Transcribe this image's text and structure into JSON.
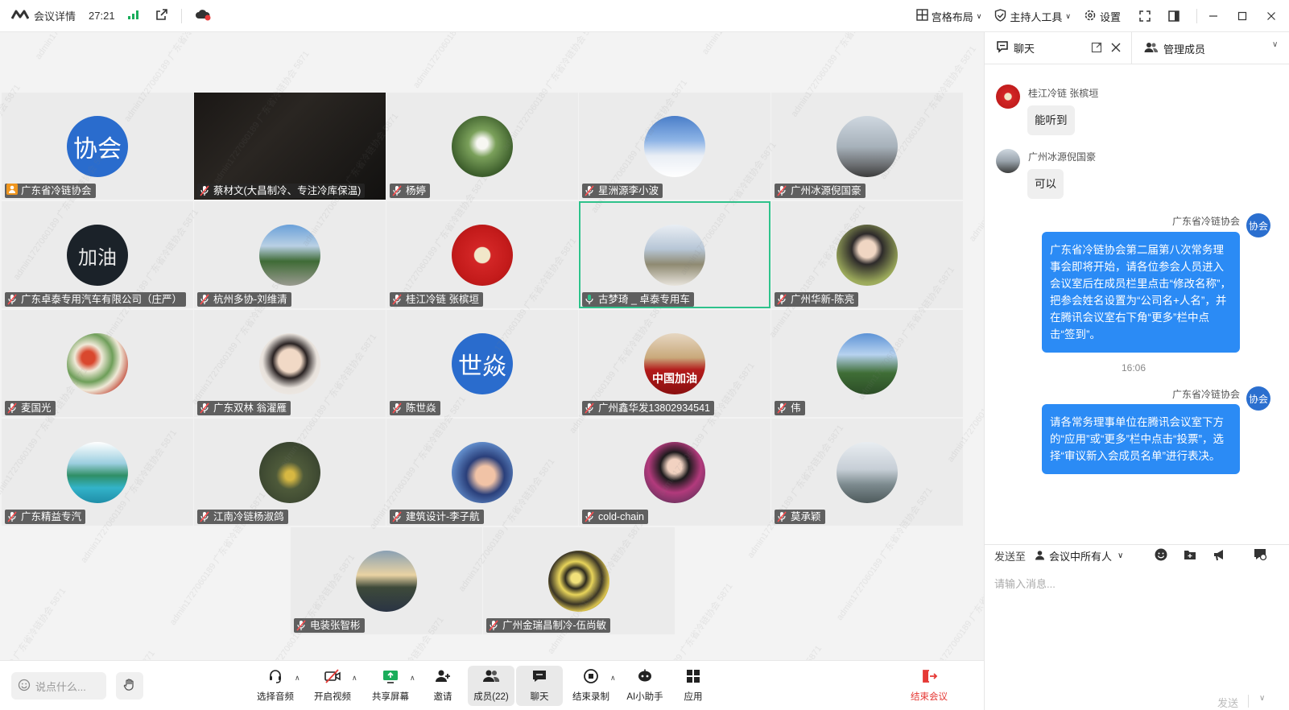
{
  "topbar": {
    "meeting_details": "会议详情",
    "timer": "27:21",
    "layout_label": "宫格布局",
    "host_tools_label": "主持人工具",
    "settings_label": "设置"
  },
  "participants": [
    {
      "name": "广东省冷链协会",
      "avatar_text": "协会",
      "role_icon": "host"
    },
    {
      "name": "蔡材文(大昌制冷、专注冷库保温)"
    },
    {
      "name": "杨婷"
    },
    {
      "name": "星洲源李小波"
    },
    {
      "name": "广州冰源倪国豪"
    },
    {
      "name": "广东卓泰专用汽车有限公司（庄严）",
      "avatar_text": "加油"
    },
    {
      "name": "杭州多协-刘维清"
    },
    {
      "name": "桂江冷链 张槟垣"
    },
    {
      "name": "古梦琦 _ 卓泰专用车",
      "active": true
    },
    {
      "name": "广州华新-陈亮"
    },
    {
      "name": "麦国光"
    },
    {
      "name": "广东双林 翁濯雁"
    },
    {
      "name": "陈世焱",
      "avatar_text": "世焱"
    },
    {
      "name": "广州鑫华发13802934541",
      "avatar_text": "中国加油"
    },
    {
      "name": "伟"
    },
    {
      "name": "广东精益专汽"
    },
    {
      "name": "江南冷链杨淑鸽"
    },
    {
      "name": "建筑设计-李子航"
    },
    {
      "name": "cold-chain"
    },
    {
      "name": "莫承颖"
    },
    {
      "name": "电装张智彬"
    },
    {
      "name": "广州金瑞昌制冷-伍尚敏"
    }
  ],
  "watermark": "admin1727060189 广东省冷链协会 5871",
  "bottombar": {
    "say_placeholder": "说点什么...",
    "audio": "选择音频",
    "video": "开启视频",
    "share": "共享屏幕",
    "invite": "邀请",
    "members": "成员(22)",
    "chat": "聊天",
    "record": "结束录制",
    "ai": "AI小助手",
    "apps": "应用",
    "end": "结束会议"
  },
  "sidebar": {
    "chat_tab": "聊天",
    "members_tab": "管理成员",
    "messages": [
      {
        "sender": "桂江冷链 张槟垣",
        "text": "能听到"
      },
      {
        "sender": "广州冰源倪国豪",
        "text": "可以"
      },
      {
        "sender": "广东省冷链协会",
        "text": "广东省冷链协会第二届第八次常务理事会即将开始，请各位参会人员进入会议室后在成员栏里点击“修改名称”，把参会姓名设置为“公司名+人名”，并在腾讯会议室右下角“更多”栏中点击“签到”。"
      },
      {
        "sender": "广东省冷链协会",
        "text": "请各常务理事单位在腾讯会议室下方的“应用”或“更多”栏中点击“投票”，选择“审议新入会成员名单”进行表决。"
      }
    ],
    "self_avatar": "协会",
    "time_divider": "16:06",
    "send_to_label": "发送至",
    "send_to_value": "会议中所有人",
    "input_placeholder": "请输入消息...",
    "send_label": "发送"
  }
}
